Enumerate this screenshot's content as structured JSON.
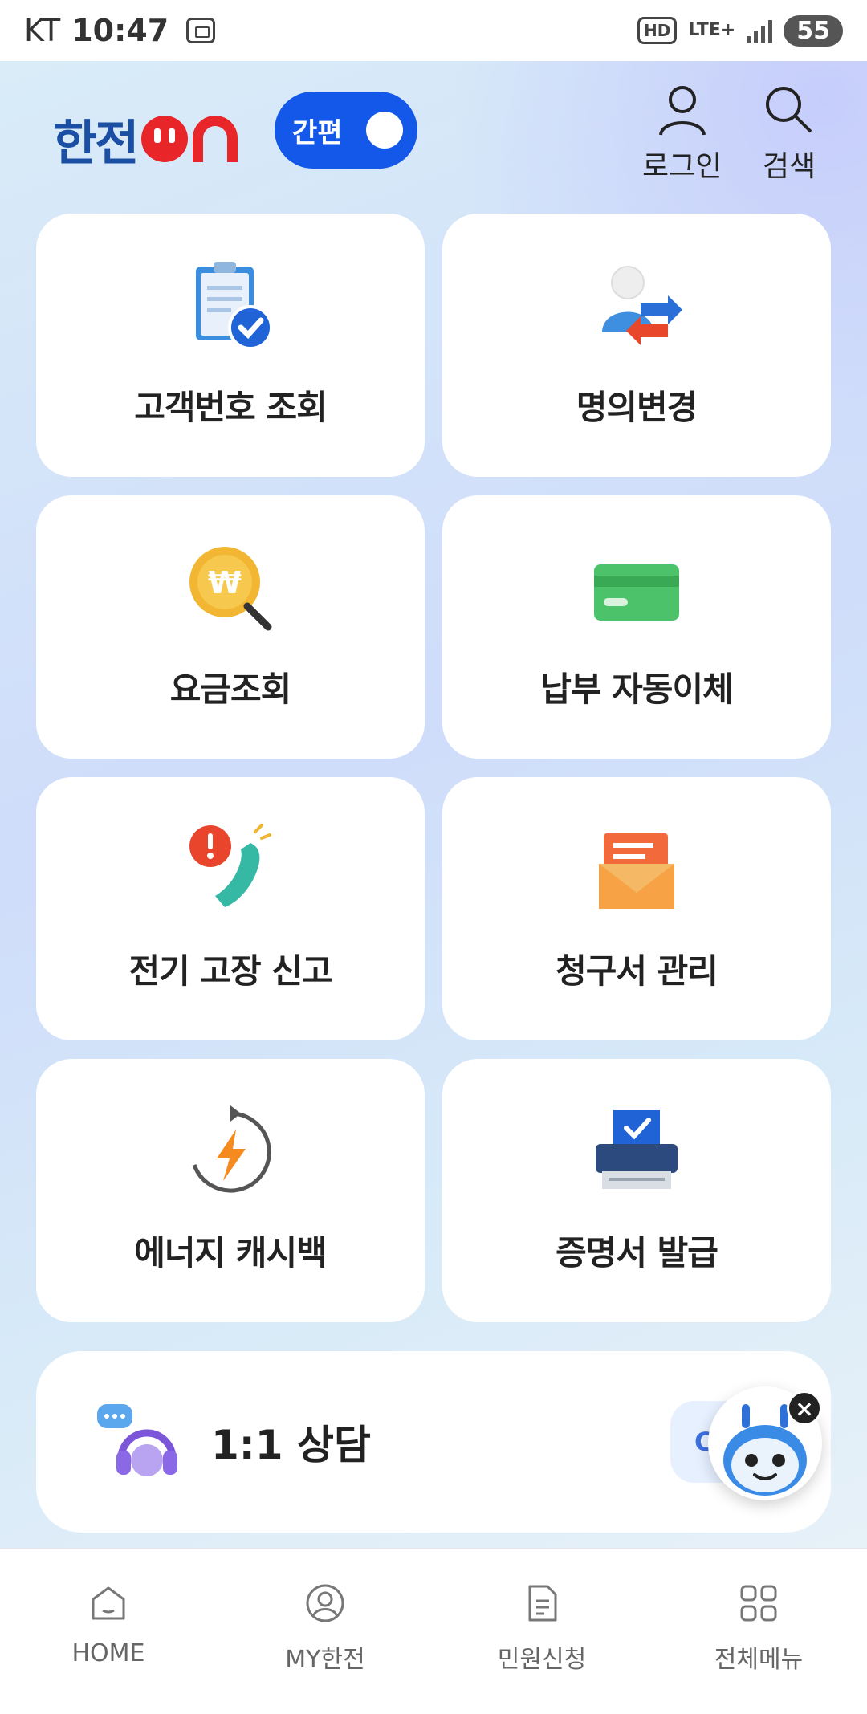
{
  "status_bar": {
    "carrier": "KT",
    "time": "10:47",
    "hd": "HD",
    "network": "LTE+",
    "battery": "55"
  },
  "header": {
    "logo_text": "한전",
    "toggle_label": "간편",
    "login_label": "로그인",
    "search_label": "검색"
  },
  "tiles": [
    {
      "label": "고객번호 조회",
      "icon": "clipboard-check-icon"
    },
    {
      "label": "명의변경",
      "icon": "person-transfer-icon"
    },
    {
      "label": "요금조회",
      "icon": "won-coin-search-icon"
    },
    {
      "label": "납부 자동이체",
      "icon": "credit-card-icon"
    },
    {
      "label": "전기 고장 신고",
      "icon": "alert-phone-icon"
    },
    {
      "label": "청구서 관리",
      "icon": "envelope-icon"
    },
    {
      "label": "에너지 캐시백",
      "icon": "lightning-cycle-icon"
    },
    {
      "label": "증명서 발급",
      "icon": "printer-icon"
    }
  ],
  "counsel": {
    "label": "1:1 상담",
    "pill_text": "C",
    "close_label": "×"
  },
  "bottom_nav": [
    {
      "label": "HOME",
      "icon": "home-icon"
    },
    {
      "label": "MY한전",
      "icon": "user-circle-icon"
    },
    {
      "label": "민원신청",
      "icon": "document-icon"
    },
    {
      "label": "전체메뉴",
      "icon": "grid-menu-icon"
    }
  ],
  "colors": {
    "brand_blue": "#1358e8",
    "logo_blue": "#1a4fa3",
    "logo_red": "#e8262a"
  }
}
